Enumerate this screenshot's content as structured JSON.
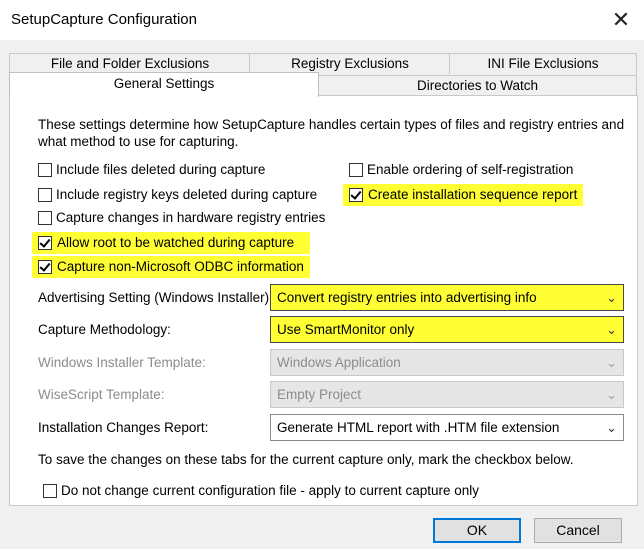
{
  "window": {
    "title": "SetupCapture Configuration",
    "close_glyph": "✕"
  },
  "tabs": {
    "back": [
      {
        "label": "File and Folder Exclusions"
      },
      {
        "label": "Registry Exclusions"
      },
      {
        "label": "INI File Exclusions"
      }
    ],
    "front": [
      {
        "label": "General Settings",
        "active": true
      },
      {
        "label": "Directories to Watch",
        "active": false
      }
    ]
  },
  "general": {
    "description": "These settings determine how SetupCapture handles certain types of files and registry entries and what method to use for capturing.",
    "options": [
      {
        "label": "Include files deleted during capture",
        "checked": false,
        "highlighted": false
      },
      {
        "label": "Include registry keys deleted during capture",
        "checked": false,
        "highlighted": false
      },
      {
        "label": "Capture changes in hardware registry entries",
        "checked": false,
        "highlighted": false
      },
      {
        "label": "Allow root to be watched during capture",
        "checked": true,
        "highlighted": true
      },
      {
        "label": "Capture non-Microsoft ODBC information",
        "checked": true,
        "highlighted": true
      },
      {
        "label": "Enable ordering of self-registration",
        "checked": false,
        "highlighted": false
      },
      {
        "label": "Create installation sequence report",
        "checked": true,
        "highlighted": true
      }
    ],
    "fields": [
      {
        "label": "Advertising Setting (Windows Installer):",
        "value": "Convert registry entries into advertising info",
        "enabled": true,
        "highlighted": true
      },
      {
        "label": "Capture Methodology:",
        "value": "Use SmartMonitor only",
        "enabled": true,
        "highlighted": true
      },
      {
        "label": "Windows Installer Template:",
        "value": "Windows Application",
        "enabled": false,
        "highlighted": false
      },
      {
        "label": "WiseScript Template:",
        "value": "Empty Project",
        "enabled": false,
        "highlighted": false
      },
      {
        "label": "Installation Changes Report:",
        "value": "Generate HTML report with .HTM file extension",
        "enabled": true,
        "highlighted": false
      }
    ],
    "note": "To save the changes on these tabs for the current capture only, mark the checkbox below.",
    "apply_current_only": {
      "label": "Do not change current configuration file - apply to current capture only",
      "checked": false
    }
  },
  "buttons": {
    "ok": "OK",
    "cancel": "Cancel"
  },
  "icons": {
    "dropdown": "chevron-down-icon",
    "close": "close-icon"
  },
  "colors": {
    "highlight": "#ffff33",
    "focus_border": "#0078d7"
  }
}
